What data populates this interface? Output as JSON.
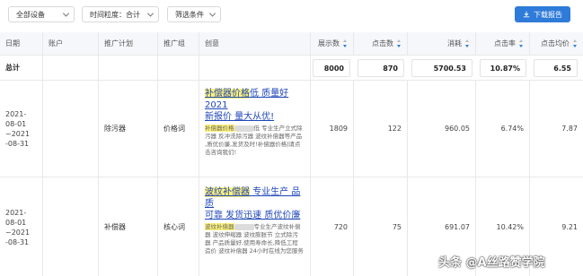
{
  "toolbar": {
    "device_filter": "全部设备",
    "time_filter": "时间粒度：合计",
    "filter_conditions": "筛选条件",
    "download_label": "下载报告"
  },
  "table": {
    "headers": [
      "日期",
      "账户",
      "推广计划",
      "推广组",
      "创意",
      "展示数",
      "点击数",
      "消耗",
      "点击率",
      "点击均价"
    ],
    "total": {
      "label": "总计",
      "impressions": "8000",
      "clicks": "870",
      "cost": "5700.53",
      "ctr": "10.87%",
      "cpc": "6.55"
    },
    "rows": [
      {
        "date": [
          "2021-",
          "08-01",
          "~2021",
          "-08-31"
        ],
        "account": "",
        "plan": "除污器",
        "group": "价格词",
        "creative_title_hl": "补偿器价格",
        "creative_title_rest": "低 质量好 2021",
        "creative_title_line2": "新报价 量大从优!",
        "creative_desc_hl": "补偿器价格",
        "creative_desc": "低 专业生产立式除污器 反冲洗除污器 波纹补偿器等产品 ,质优价廉,发货及时!补偿器价格|请点击咨询我们!",
        "impressions": "1809",
        "clicks": "122",
        "cost": "960.05",
        "ctr": "6.74%",
        "cpc": "7.87"
      },
      {
        "date": [
          "2021-",
          "08-01",
          "~2021",
          "-08-31"
        ],
        "account": "",
        "plan": "补偿器",
        "group": "核心词",
        "creative_title_hl": "波纹补偿器",
        "creative_title_rest": " 专业生产 品质",
        "creative_title_line2": "可靠 发货迅速 质优价廉",
        "creative_desc_hl": "波纹补偿器",
        "creative_desc": "专业生产波纹补偿器 波纹伸缩器 波纹膨胀节 立式除污器 产品质量好,使用寿命长,降低工程造价 波纹补偿器 24小时在线为您服务",
        "impressions": "720",
        "clicks": "75",
        "cost": "691.07",
        "ctr": "10.42%",
        "cpc": "9.21"
      }
    ]
  },
  "watermark": "头条 @A丝路赞学院"
}
